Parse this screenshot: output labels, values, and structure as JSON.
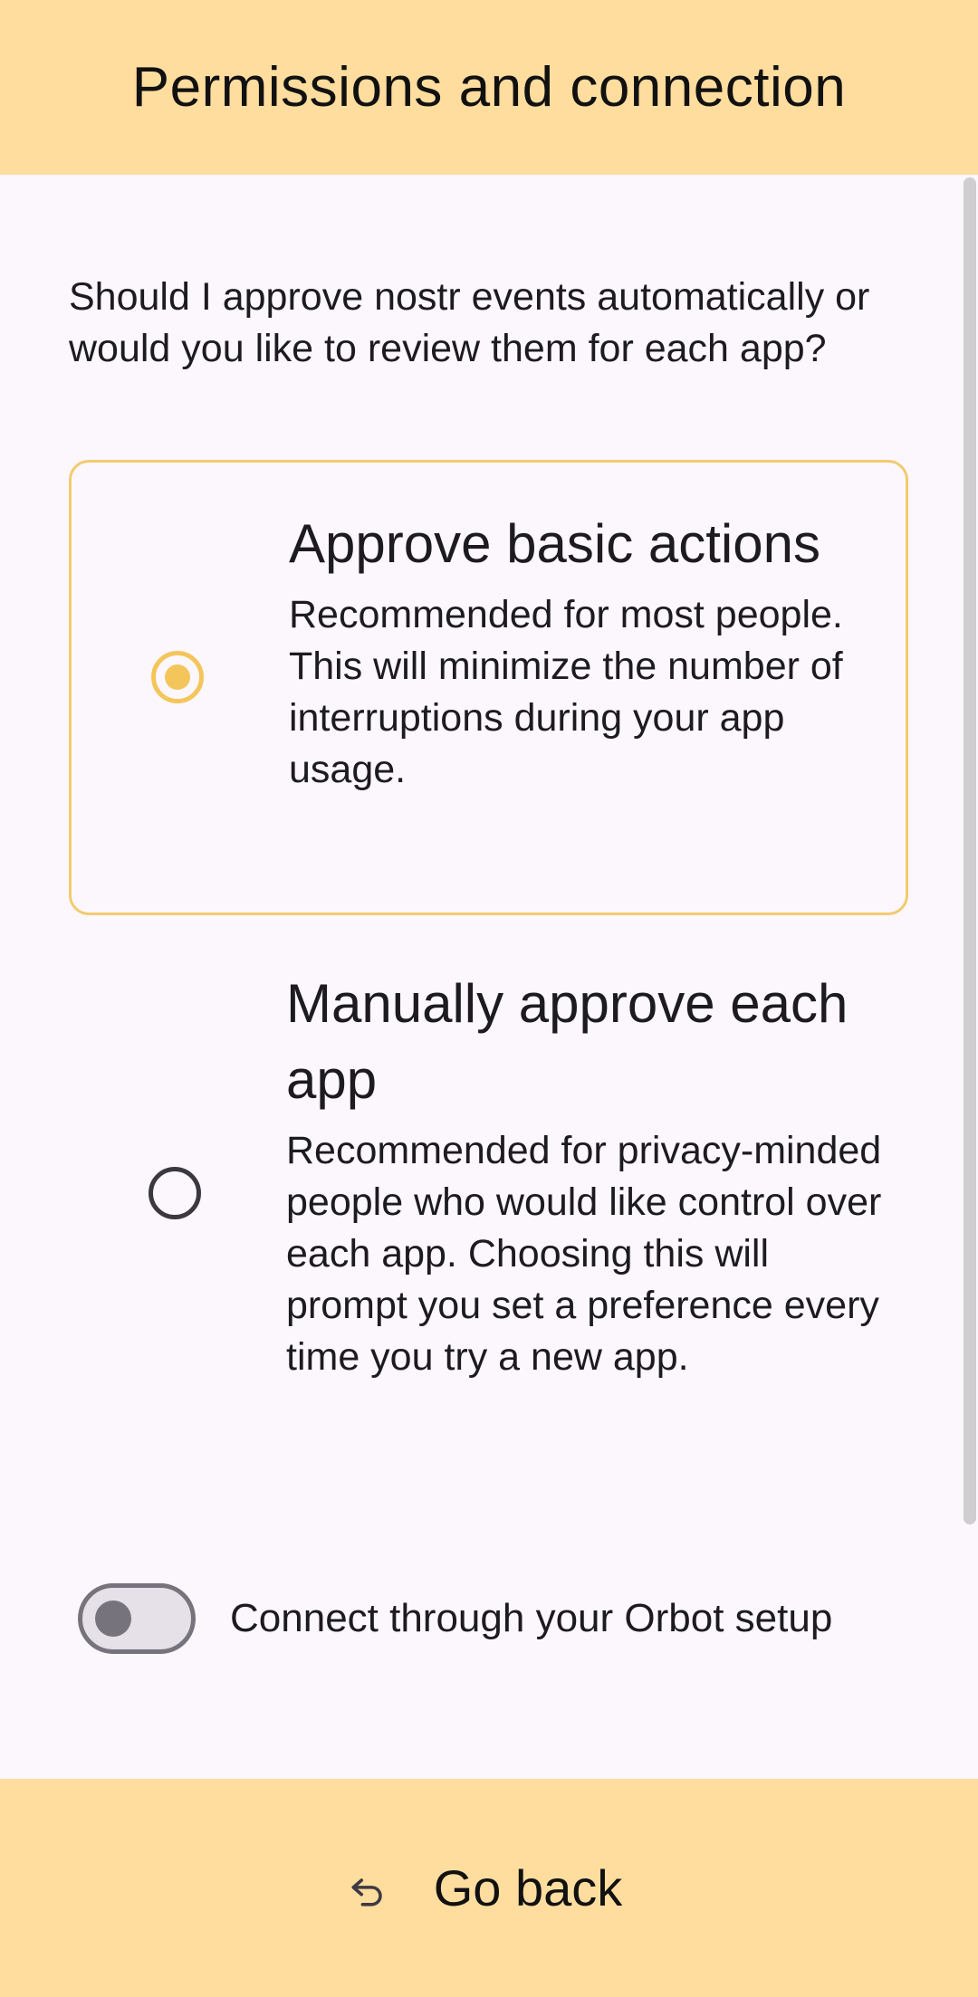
{
  "header": {
    "title": "Permissions and connection"
  },
  "question": "Should I approve nostr events automatically or would you like to review them for each app?",
  "options": [
    {
      "title": "Approve basic actions",
      "description": "Recommended for most people. This will minimize the number of interruptions during your app usage.",
      "selected": true
    },
    {
      "title": "Manually approve each app",
      "description": "Recommended for privacy-minded people who would like control over each app. Choosing this will prompt you set a preference every time you try a new app.",
      "selected": false
    }
  ],
  "orbot": {
    "label": "Connect through your Orbot setup",
    "enabled": false
  },
  "footer": {
    "go_back_label": "Go back",
    "icon": "undo-icon"
  },
  "colors": {
    "bar_background": "#FFDD9E",
    "page_background": "#FCF7FD",
    "accent": "#F4C55B",
    "selected_border": "#F2CB6E"
  }
}
